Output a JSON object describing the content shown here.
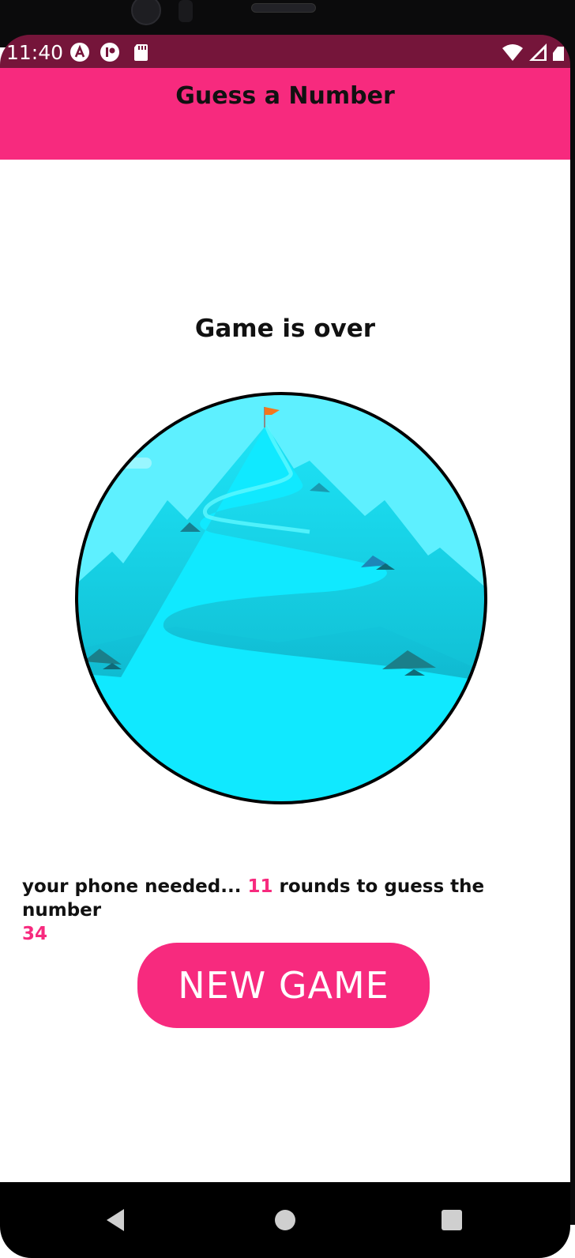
{
  "status_bar": {
    "time": "11:40",
    "icons": [
      "a-circle-icon",
      "r-circle-icon",
      "sd-card-icon"
    ],
    "right_icons": [
      "wifi-icon",
      "signal-icon",
      "battery-icon"
    ]
  },
  "app_bar": {
    "title": "Guess a Number"
  },
  "main": {
    "heading": "Game is over",
    "result": {
      "prefix": "your phone needed...",
      "rounds": "11",
      "middle": "rounds to guess the number",
      "number": "34"
    },
    "new_game_label": "NEW GAME"
  },
  "nav": {
    "buttons": [
      "back-icon",
      "home-icon",
      "recents-icon"
    ]
  },
  "colors": {
    "accent": "#f72a7e",
    "status_bar": "#75153a",
    "sky": "#5ef0ff",
    "water": "#10e9ff"
  }
}
